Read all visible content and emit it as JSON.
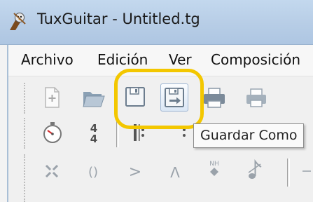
{
  "window": {
    "title": "TuxGuitar - Untitled.tg"
  },
  "menu": {
    "items": [
      "Archivo",
      "Edición",
      "Ver",
      "Composición"
    ]
  },
  "toolbar": {
    "tooltip": "Guardar Como",
    "time_signature": {
      "top": "4",
      "bottom": "4"
    },
    "tuplet_label": "()",
    "natural_harmonic_label": "NH",
    "accent_label": ">",
    "heavy_accent_label": "Λ"
  },
  "colors": {
    "highlight": "#f3c700",
    "titlebar": "#b7cde6"
  }
}
